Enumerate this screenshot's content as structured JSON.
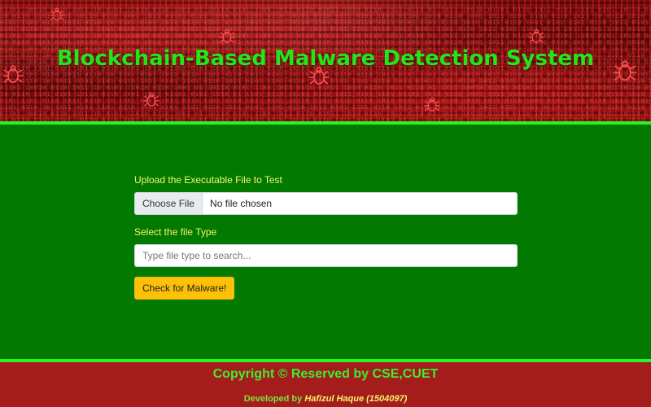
{
  "header": {
    "title": "Blockchain-Based Malware Detection System"
  },
  "form": {
    "upload_label": "Upload the Executable File to Test",
    "choose_file_label": "Choose File",
    "file_status": "No file chosen",
    "type_label": "Select the file Type",
    "type_placeholder": "Type file type to search...",
    "check_button_label": "Check for Malware!"
  },
  "footer": {
    "copyright": "Copyright © Reserved by CSE,CUET",
    "developed_by": "Developed by",
    "developer_name": "Hafizul Haque (1504097)"
  },
  "colors": {
    "title_green": "#22e51a",
    "main_green": "#027a02",
    "footer_red": "#a41c1c",
    "button_yellow": "#ffc107"
  }
}
